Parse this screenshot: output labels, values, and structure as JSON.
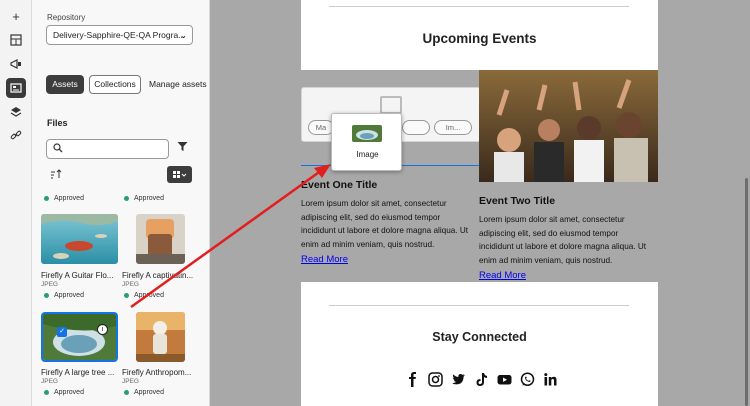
{
  "rail": {
    "icons": [
      "plus-icon",
      "layout-icon",
      "megaphone-icon",
      "assets-icon",
      "layers-icon",
      "link-icon"
    ]
  },
  "panel": {
    "repository_label": "Repository",
    "repository_value": "Delivery-Sapphire-QE-QA Progra...",
    "tabs": {
      "assets": "Assets",
      "collections": "Collections",
      "manage": "Manage assets"
    },
    "files_title": "Files",
    "search_placeholder": "",
    "cards": [
      {
        "status": "Approved"
      },
      {
        "status": "Approved"
      },
      {
        "title": "Firefly A Guitar Flo...",
        "type": "JPEG",
        "status": "Approved"
      },
      {
        "title": "Firefly A captivatin...",
        "type": "JPEG",
        "status": "Approved"
      },
      {
        "title": "Firefly A large tree ...",
        "type": "JPEG",
        "status": "Approved"
      },
      {
        "title": "Firefly Anthropom...",
        "type": "JPEG",
        "status": "Approved"
      }
    ]
  },
  "canvas": {
    "upcoming_title": "Upcoming Events",
    "placeholder_buttons": [
      "Ma",
      "Im..."
    ],
    "drag_label": "Image",
    "event_one": {
      "title": "Event One Title",
      "body": "Lorem ipsum dolor sit amet, consectetur adipiscing elit, sed do eiusmod tempor incididunt ut labore et dolore magna aliqua. Ut enim ad minim veniam, quis nostrud.",
      "link": "Read More"
    },
    "event_two": {
      "title": "Event Two Title",
      "body": "Lorem ipsum dolor sit amet, consectetur adipiscing elit, sed do eiusmod tempor incididunt ut labore et dolore magna aliqua. Ut enim ad minim veniam, quis nostrud.",
      "link": "Read More"
    },
    "stay_title": "Stay Connected",
    "social_icons": [
      "facebook-icon",
      "instagram-icon",
      "twitter-icon",
      "tiktok-icon",
      "youtube-icon",
      "whatsapp-icon",
      "linkedin-icon"
    ]
  },
  "colors": {
    "accent": "#1473e6",
    "approved": "#2d9d78",
    "arrow": "#e0201e",
    "link": "#0000ee"
  }
}
